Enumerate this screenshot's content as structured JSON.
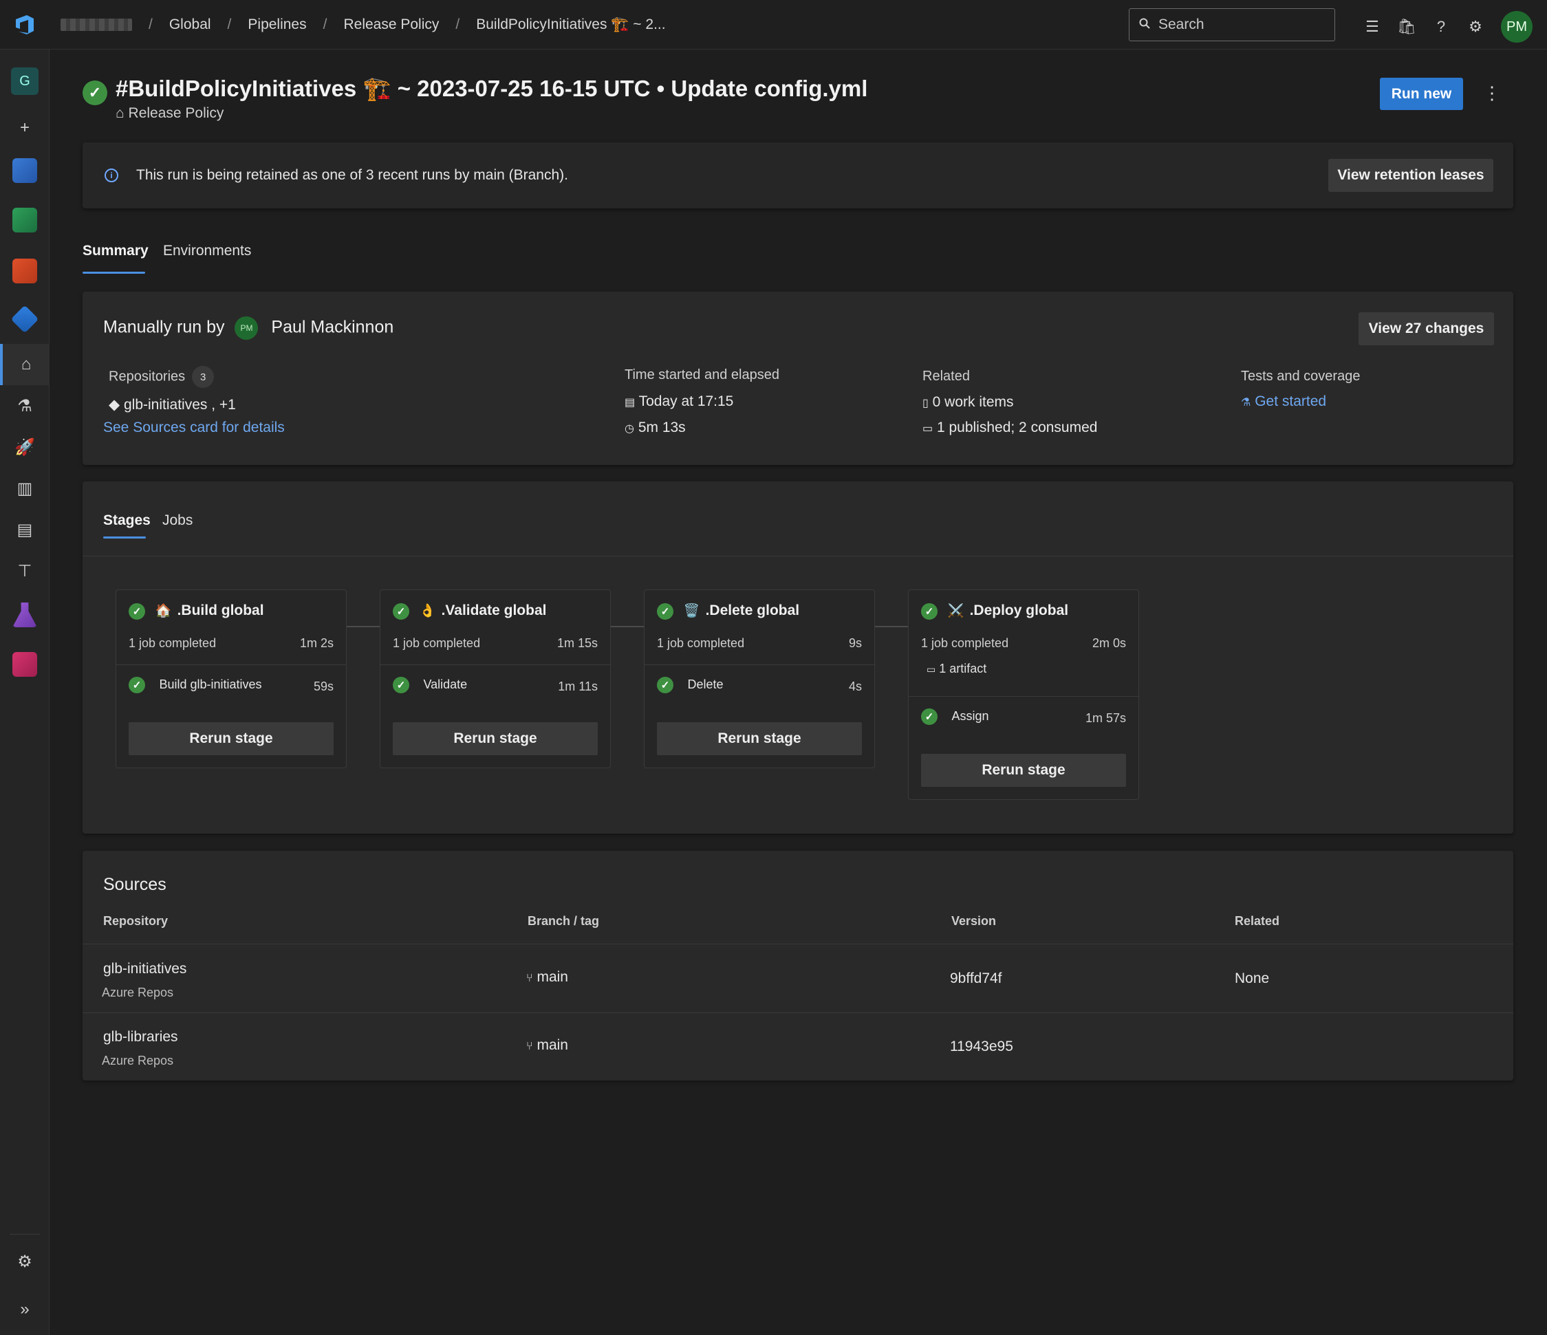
{
  "breadcrumbs": [
    "Global",
    "Pipelines",
    "Release Policy",
    "BuildPolicyInitiatives 🏗️ ~ 2..."
  ],
  "search": {
    "placeholder": "Search"
  },
  "user": {
    "initials": "PM"
  },
  "nav": {
    "org_initial": "G"
  },
  "run": {
    "title": "#BuildPolicyInitiatives 🏗️ ~ 2023-07-25 16-15 UTC • Update config.yml",
    "pipeline": "Release Policy",
    "run_new": "Run new"
  },
  "banner": {
    "message": "This run is being retained as one of 3 recent runs by main (Branch).",
    "button": "View retention leases"
  },
  "tabs": [
    "Summary",
    "Environments"
  ],
  "summary": {
    "manual_prefix": "Manually run by",
    "user_initials": "PM",
    "user_name": "Paul Mackinnon",
    "view_changes": "View 27 changes",
    "repositories_label": "Repositories",
    "repositories_count": "3",
    "repo_primary": "glb-initiatives",
    "repo_more": ", +1",
    "sources_link": "See Sources card for details",
    "time_label": "Time started and elapsed",
    "started": "Today at 17:15",
    "elapsed": "5m 13s",
    "related_label": "Related",
    "work_items": "0 work items",
    "artifacts": "1 published; 2 consumed",
    "tests_label": "Tests and coverage",
    "tests_link": "Get started"
  },
  "stage_tabs": [
    "Stages",
    "Jobs"
  ],
  "stages": [
    {
      "icon": "🏠",
      "name": ".Build global",
      "jobs": "1 job completed",
      "duration": "1m 2s",
      "artifact": "",
      "job_name": "Build glb-initiatives",
      "job_duration": "59s",
      "rerun": "Rerun stage"
    },
    {
      "icon": "👌",
      "name": ".Validate global",
      "jobs": "1 job completed",
      "duration": "1m 15s",
      "artifact": "",
      "job_name": "Validate",
      "job_duration": "1m 11s",
      "rerun": "Rerun stage"
    },
    {
      "icon": "🗑️",
      "name": ".Delete global",
      "jobs": "1 job completed",
      "duration": "9s",
      "artifact": "",
      "job_name": "Delete",
      "job_duration": "4s",
      "rerun": "Rerun stage"
    },
    {
      "icon": "⚔️",
      "name": ".Deploy global",
      "jobs": "1 job completed",
      "duration": "2m 0s",
      "artifact": "1 artifact",
      "job_name": "Assign",
      "job_duration": "1m 57s",
      "rerun": "Rerun stage"
    }
  ],
  "sources": {
    "title": "Sources",
    "columns": [
      "Repository",
      "Branch / tag",
      "Version",
      "Related"
    ],
    "rows": [
      {
        "repo": "glb-initiatives",
        "provider": "Azure Repos",
        "branch": "main",
        "version": "9bffd74f",
        "related": "None"
      },
      {
        "repo": "glb-libraries",
        "provider": "Azure Repos",
        "branch": "main",
        "version": "11943e95",
        "related": ""
      }
    ]
  },
  "colors": {
    "accent": "#2b78d0",
    "success": "#3f9142",
    "link": "#6ea8f0"
  }
}
